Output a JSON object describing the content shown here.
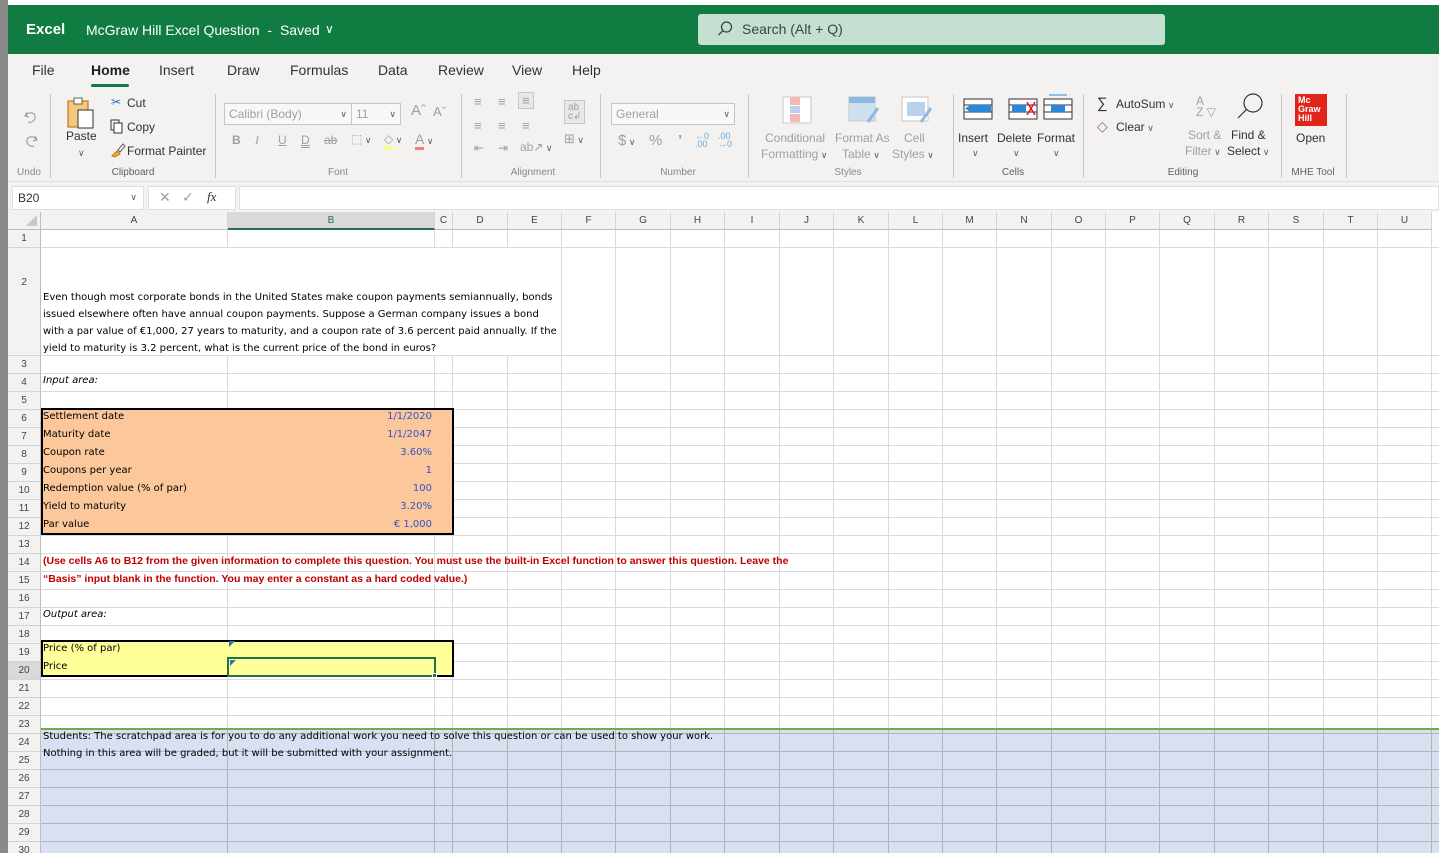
{
  "titlebar": {
    "app": "Excel",
    "document": "McGraw Hill Excel Question",
    "separator": "-",
    "status": "Saved",
    "search_placeholder": "Search (Alt + Q)"
  },
  "tabs": [
    "File",
    "Home",
    "Insert",
    "Draw",
    "Formulas",
    "Data",
    "Review",
    "View",
    "Help"
  ],
  "active_tab": "Home",
  "ribbon": {
    "undo": {
      "group": "Undo"
    },
    "clipboard": {
      "paste": "Paste",
      "cut": "Cut",
      "copy": "Copy",
      "format_painter": "Format Painter",
      "group": "Clipboard"
    },
    "font": {
      "family": "Calibri (Body)",
      "size": "11",
      "bold": "B",
      "italic": "I",
      "underline": "U",
      "double_underline": "D",
      "strike": "ab",
      "group": "Font"
    },
    "alignment": {
      "group": "Alignment"
    },
    "number": {
      "format": "General",
      "currency": "$",
      "percent": "%",
      "comma": "9",
      "group": "Number"
    },
    "styles": {
      "conditional_1": "Conditional",
      "conditional_2": "Formatting",
      "format_table_1": "Format As",
      "format_table_2": "Table",
      "cell_styles_1": "Cell",
      "cell_styles_2": "Styles",
      "group": "Styles"
    },
    "cells": {
      "insert": "Insert",
      "delete": "Delete",
      "format": "Format",
      "group": "Cells"
    },
    "editing": {
      "autosum": "AutoSum",
      "clear": "Clear",
      "sort_1": "Sort &",
      "sort_2": "Filter",
      "find_1": "Find &",
      "find_2": "Select",
      "group": "Editing"
    },
    "mhe": {
      "logo_1": "Mc",
      "logo_2": "Graw",
      "logo_3": "Hill",
      "open": "Open",
      "group": "MHE Tool"
    }
  },
  "formula_bar": {
    "name_box": "B20",
    "formula": "",
    "fx": "fx"
  },
  "columns": [
    "A",
    "B",
    "C",
    "D",
    "E",
    "F",
    "G",
    "H",
    "I",
    "J",
    "K",
    "L",
    "M",
    "N",
    "O",
    "P",
    "Q",
    "R",
    "S",
    "T",
    "U"
  ],
  "selected_column": "B",
  "selected_row": "20",
  "rows": [
    "1",
    "2",
    "3",
    "4",
    "5",
    "6",
    "7",
    "8",
    "9",
    "10",
    "11",
    "12",
    "13",
    "14",
    "15",
    "16",
    "17",
    "18",
    "19",
    "20",
    "21",
    "22",
    "23",
    "24",
    "25",
    "26",
    "27",
    "28",
    "29",
    "30"
  ],
  "sheet": {
    "question": "Even though most corporate bonds in the United States make coupon payments semiannually, bonds issued elsewhere often have annual coupon payments. Suppose a German company issues a bond with a par value of €1,000, 27 years to maturity, and a coupon rate of 3.6 percent paid annually. If the yield to maturity is 3.2 percent, what is the current price of the bond in euros?",
    "input_label": "Input area:",
    "inputs": [
      {
        "label": "Settlement date",
        "value": "1/1/2020"
      },
      {
        "label": "Maturity date",
        "value": "1/1/2047"
      },
      {
        "label": "Coupon rate",
        "value": "3.60%"
      },
      {
        "label": "Coupons per year",
        "value": "1"
      },
      {
        "label": "Redemption value (% of par)",
        "value": "100"
      },
      {
        "label": "Yield to maturity",
        "value": "3.20%"
      },
      {
        "label": "Par value",
        "value": "€ 1,000"
      }
    ],
    "instruction_1": "(Use cells A6 to B12 from the given information to complete this question. You must use the built-in Excel function to answer this question. Leave the",
    "instruction_2": "“Basis” input blank in the function. You may enter a constant as a hard coded value.)",
    "output_label": "Output area:",
    "outputs": [
      {
        "label": "Price (% of par)",
        "value": ""
      },
      {
        "label": "Price",
        "value": ""
      }
    ],
    "scratch_1": "Students: The scratchpad area is for you to do any additional work you need to solve this question or can be used to show your work.",
    "scratch_2": "Nothing in this area will be graded, but it will be submitted with your assignment."
  },
  "colors": {
    "brand": "#107c41",
    "input_fill": "#fcc89b",
    "output_fill": "#ffff99",
    "scratch_fill": "#d9e0f1",
    "instruction_text": "#c00000",
    "input_values": "#2f54c9"
  }
}
